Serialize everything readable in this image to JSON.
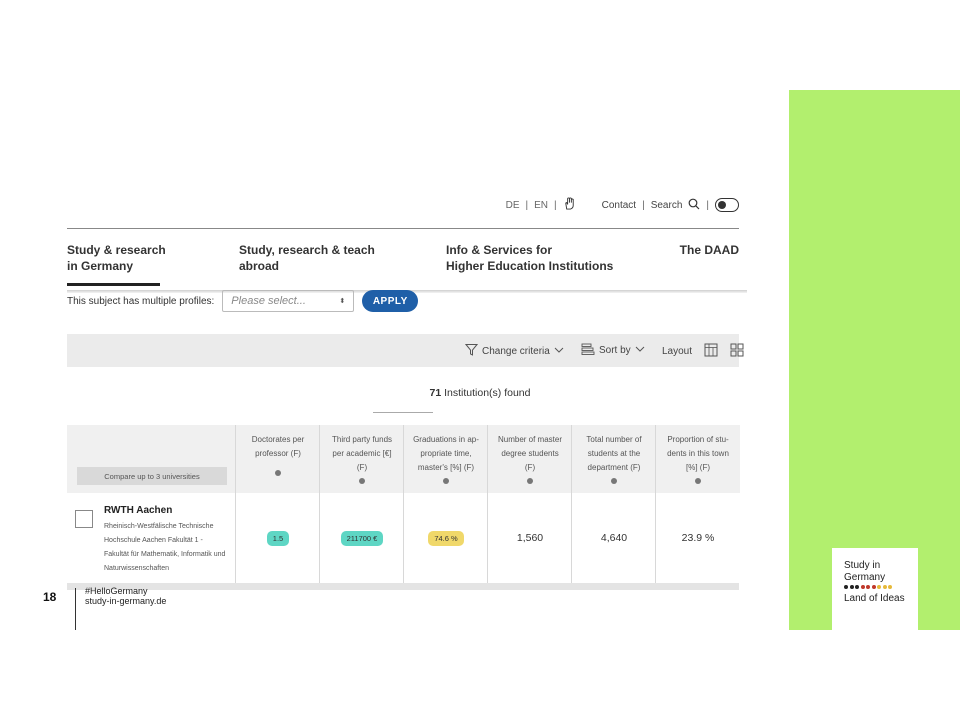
{
  "utility": {
    "lang_de": "DE",
    "lang_sep1": "|",
    "lang_en": "EN",
    "lang_sep2": "|",
    "contact": "Contact",
    "search": "Search",
    "sep": "|"
  },
  "nav": {
    "items": [
      {
        "label": "Study & research\nin Germany"
      },
      {
        "label": "Study, research & teach\nabroad"
      },
      {
        "label": "Info & Services for\nHigher Education Institutions"
      },
      {
        "label": "The DAAD"
      }
    ]
  },
  "profiles": {
    "label": "This subject has multiple profiles:",
    "placeholder": "Please select...",
    "apply": "APPLY"
  },
  "toolbar": {
    "change_criteria": "Change criteria",
    "sort_by": "Sort by",
    "layout": "Layout"
  },
  "results": {
    "count": "71",
    "suffix": " Institution(s) found"
  },
  "table": {
    "compare_label": "Compare up to 3 universities",
    "headers": [
      "Doctorates per\nprofessor (F)",
      "Third party funds\nper academic [€]\n(F)",
      "Graduations in ap-\npropriate time,\nmaster's [%] (F)",
      "Number of master\ndegree students\n(F)",
      "Total number of\nstudents at the\ndepartment (F)",
      "Proportion of stu-\ndents in this town\n[%] (F)"
    ],
    "row": {
      "name": "RWTH Aachen",
      "description": "Rheinisch-Westfälische Technische Hochschule Aachen Fakultät 1 - Fakultät für Mathematik, Informatik und Naturwissenschaften",
      "values": [
        "1.5",
        "211700 €",
        "74.6 %",
        "1,560",
        "4,640",
        "23.9 %"
      ]
    },
    "pill_colors": {
      "teal": "#5ed6c4",
      "yellow": "#f0d86a"
    }
  },
  "footer": {
    "page": "18",
    "hashtag": "#HelloGermany",
    "site": "study-in-germany.de"
  },
  "logo": {
    "line1": "Study in",
    "line2": "Germany",
    "line3": "Land of Ideas",
    "dot_colors": [
      "#222222",
      "#222222",
      "#222222",
      "#c0392b",
      "#c0392b",
      "#c0392b",
      "#e6b93a",
      "#e6b93a",
      "#e6b93a"
    ]
  },
  "colors": {
    "accent_green": "#b2ef6e",
    "apply_blue": "#1f5fa8"
  }
}
